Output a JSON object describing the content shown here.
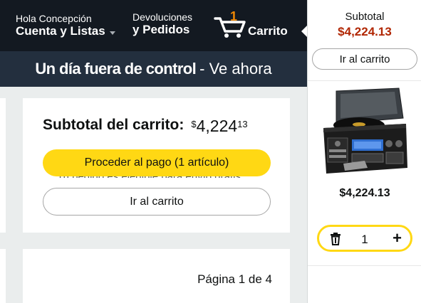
{
  "header": {
    "account_greeting": "Hola Concepción",
    "account_lists": "Cuenta y Listas",
    "returns_line1": "Devoluciones",
    "returns_line2": "y Pedidos",
    "cart_count": "1",
    "cart_label": "Carrito"
  },
  "promo": {
    "bold_text": "Un día fuera de control",
    "rest_text": "- Ve ahora"
  },
  "cart_summary": {
    "subtotal_label": "Subtotal del carrito:",
    "price_symbol": "$",
    "price_whole": "4,224",
    "price_fraction": "13",
    "checkout_button": "Proceder al pago (1 artículo)",
    "obscured_text": "Tu pedido es elegible para envío gratis",
    "go_to_cart_button": "Ir al carrito"
  },
  "pagination": {
    "text": "Página 1 de 4"
  },
  "sidebar": {
    "subtotal_label": "Subtotal",
    "subtotal_price": "$4,224.13",
    "go_to_cart_button": "Ir al carrito",
    "item_price": "$4,224.13",
    "item_quantity": "1",
    "product_image": "turntable-stereo-image"
  },
  "colors": {
    "header_bg": "#131921",
    "promo_bg": "#232f3e",
    "cart_count": "#f08804",
    "checkout_button": "#ffd814",
    "sidebar_price": "#b12704"
  },
  "icons": [
    "caret-down-icon",
    "cart-icon",
    "trash-icon",
    "plus-icon"
  ]
}
